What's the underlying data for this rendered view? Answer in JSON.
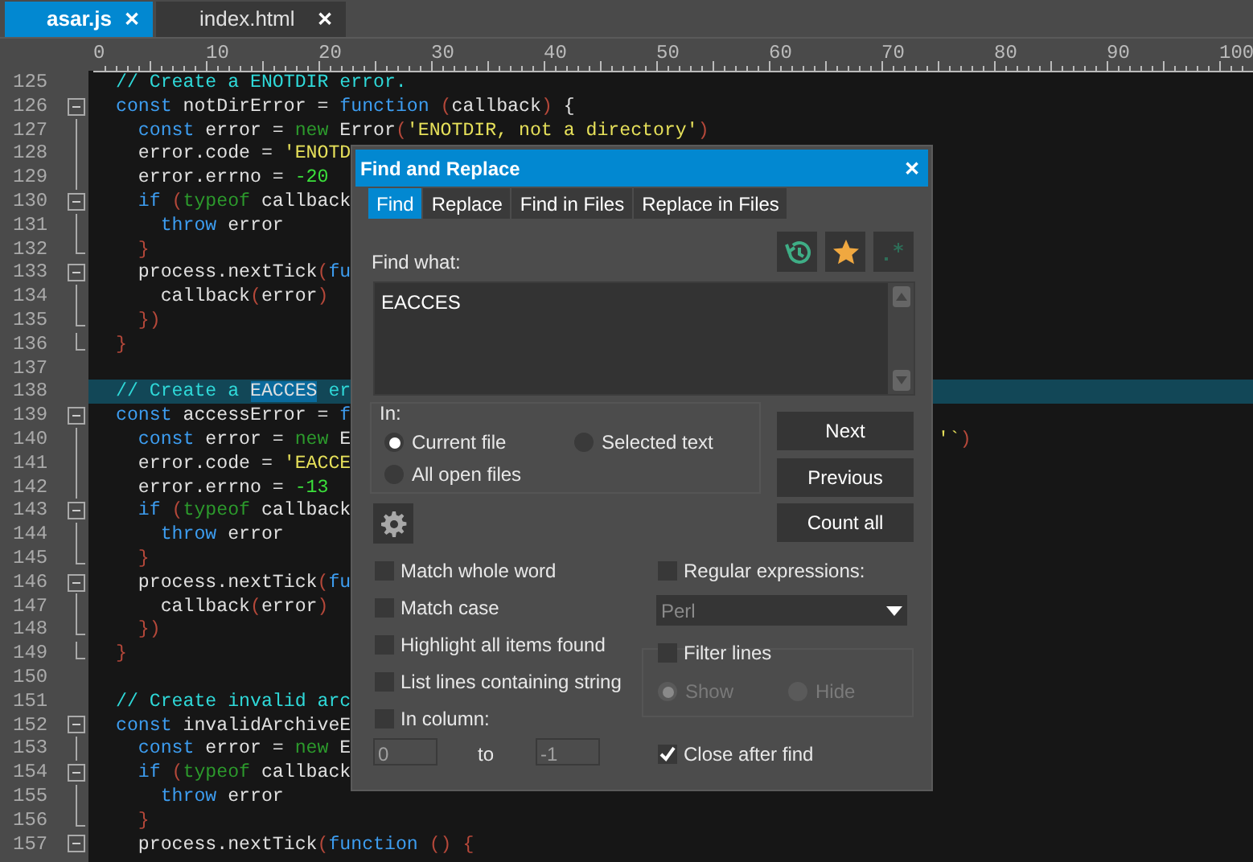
{
  "tabs": [
    {
      "label": "asar.js",
      "selected": true,
      "close": "✕"
    },
    {
      "label": "index.html",
      "selected": false,
      "close": "✕"
    }
  ],
  "ruler": [
    "0",
    "10",
    "20",
    "30",
    "40",
    "50",
    "60",
    "70",
    "80",
    "90",
    "100"
  ],
  "code": [
    {
      "n": "125",
      "kind": "plain",
      "tokens": [
        {
          "kind": "comment",
          "text": "// Create a ENOTDIR error."
        }
      ]
    },
    {
      "n": "126",
      "kind": "fold_start",
      "tokens": [
        {
          "kind": "keyword",
          "text": "const"
        },
        {
          "kind": "plain",
          "text": " notDirError = "
        },
        {
          "kind": "keyword",
          "text": "function"
        },
        {
          "kind": "paren",
          "text": " ("
        },
        {
          "kind": "plain",
          "text": "callback"
        },
        {
          "kind": "paren",
          "text": ")"
        },
        {
          "kind": "plain",
          "text": " {"
        }
      ]
    },
    {
      "n": "127",
      "kind": "fold_body",
      "tokens": [
        {
          "kind": "keyword",
          "text": "  const"
        },
        {
          "kind": "plain",
          "text": " error = "
        },
        {
          "kind": "operator",
          "text": "new"
        },
        {
          "kind": "plain",
          "text": " Error"
        },
        {
          "kind": "paren",
          "text": "("
        },
        {
          "kind": "string",
          "text": "'ENOTDIR, not a directory'"
        },
        {
          "kind": "paren",
          "text": ")"
        }
      ]
    },
    {
      "n": "128",
      "kind": "fold_body",
      "tokens": [
        {
          "kind": "plain",
          "text": "  error.code = "
        },
        {
          "kind": "string",
          "text": "'ENOTD"
        }
      ]
    },
    {
      "n": "129",
      "kind": "fold_body",
      "tokens": [
        {
          "kind": "plain",
          "text": "  error.errno = "
        },
        {
          "kind": "number",
          "text": "-20"
        }
      ]
    },
    {
      "n": "130",
      "kind": "fold_start",
      "tokens": [
        {
          "kind": "keyword",
          "text": "  if"
        },
        {
          "kind": "paren",
          "text": " ("
        },
        {
          "kind": "operator",
          "text": "typeof"
        },
        {
          "kind": "plain",
          "text": " callback"
        }
      ]
    },
    {
      "n": "131",
      "kind": "fold_body",
      "tokens": [
        {
          "kind": "keyword",
          "text": "    throw"
        },
        {
          "kind": "plain",
          "text": " error"
        }
      ]
    },
    {
      "n": "132",
      "kind": "fold_end",
      "tokens": [
        {
          "kind": "paren",
          "text": "  }"
        }
      ]
    },
    {
      "n": "133",
      "kind": "fold_start",
      "tokens": [
        {
          "kind": "plain",
          "text": "  process.nextTick"
        },
        {
          "kind": "paren",
          "text": "("
        },
        {
          "kind": "keyword",
          "text": "fu"
        }
      ]
    },
    {
      "n": "134",
      "kind": "fold_body",
      "tokens": [
        {
          "kind": "plain",
          "text": "    callback"
        },
        {
          "kind": "paren",
          "text": "("
        },
        {
          "kind": "plain",
          "text": "error"
        },
        {
          "kind": "paren",
          "text": ")"
        }
      ]
    },
    {
      "n": "135",
      "kind": "fold_end",
      "tokens": [
        {
          "kind": "paren",
          "text": "  })"
        }
      ]
    },
    {
      "n": "136",
      "kind": "fold_end",
      "tokens": [
        {
          "kind": "paren",
          "text": "}"
        }
      ]
    },
    {
      "n": "137",
      "kind": "plain"
    },
    {
      "n": "138",
      "kind": "plain",
      "current": true,
      "tokens": [
        {
          "kind": "comment",
          "text": "// Create a "
        },
        {
          "kind": "match",
          "text": "EACCES"
        },
        {
          "kind": "comment",
          "text": " er"
        }
      ]
    },
    {
      "n": "139",
      "kind": "fold_start",
      "tokens": [
        {
          "kind": "keyword",
          "text": "const"
        },
        {
          "kind": "plain",
          "text": " accessError = "
        },
        {
          "kind": "keyword",
          "text": "f"
        }
      ]
    },
    {
      "n": "140",
      "kind": "fold_body",
      "tokens": [
        {
          "kind": "keyword",
          "text": "  const"
        },
        {
          "kind": "plain",
          "text": " error = "
        },
        {
          "kind": "operator",
          "text": "new"
        },
        {
          "kind": "plain",
          "text": " E"
        }
      ],
      "tail": [
        {
          "kind": "string",
          "text": "'`"
        },
        {
          "kind": "paren",
          "text": ")"
        }
      ]
    },
    {
      "n": "141",
      "kind": "fold_body",
      "tokens": [
        {
          "kind": "plain",
          "text": "  error.code = "
        },
        {
          "kind": "string",
          "text": "'EACCE"
        }
      ]
    },
    {
      "n": "142",
      "kind": "fold_body",
      "tokens": [
        {
          "kind": "plain",
          "text": "  error.errno = "
        },
        {
          "kind": "number",
          "text": "-13"
        }
      ]
    },
    {
      "n": "143",
      "kind": "fold_start",
      "tokens": [
        {
          "kind": "keyword",
          "text": "  if"
        },
        {
          "kind": "paren",
          "text": " ("
        },
        {
          "kind": "operator",
          "text": "typeof"
        },
        {
          "kind": "plain",
          "text": " callback"
        }
      ]
    },
    {
      "n": "144",
      "kind": "fold_body",
      "tokens": [
        {
          "kind": "keyword",
          "text": "    throw"
        },
        {
          "kind": "plain",
          "text": " error"
        }
      ]
    },
    {
      "n": "145",
      "kind": "fold_end",
      "tokens": [
        {
          "kind": "paren",
          "text": "  }"
        }
      ]
    },
    {
      "n": "146",
      "kind": "fold_start",
      "tokens": [
        {
          "kind": "plain",
          "text": "  process.nextTick"
        },
        {
          "kind": "paren",
          "text": "("
        },
        {
          "kind": "keyword",
          "text": "fu"
        }
      ]
    },
    {
      "n": "147",
      "kind": "fold_body",
      "tokens": [
        {
          "kind": "plain",
          "text": "    callback"
        },
        {
          "kind": "paren",
          "text": "("
        },
        {
          "kind": "plain",
          "text": "error"
        },
        {
          "kind": "paren",
          "text": ")"
        }
      ]
    },
    {
      "n": "148",
      "kind": "fold_end",
      "tokens": [
        {
          "kind": "paren",
          "text": "  })"
        }
      ]
    },
    {
      "n": "149",
      "kind": "fold_end",
      "tokens": [
        {
          "kind": "paren",
          "text": "}"
        }
      ]
    },
    {
      "n": "150",
      "kind": "plain"
    },
    {
      "n": "151",
      "kind": "plain",
      "tokens": [
        {
          "kind": "comment",
          "text": "// Create invalid arc"
        }
      ]
    },
    {
      "n": "152",
      "kind": "fold_start",
      "tokens": [
        {
          "kind": "keyword",
          "text": "const"
        },
        {
          "kind": "plain",
          "text": " invalidArchiveE"
        }
      ]
    },
    {
      "n": "153",
      "kind": "fold_body",
      "tokens": [
        {
          "kind": "keyword",
          "text": "  const"
        },
        {
          "kind": "plain",
          "text": " error = "
        },
        {
          "kind": "operator",
          "text": "new"
        },
        {
          "kind": "plain",
          "text": " E"
        }
      ]
    },
    {
      "n": "154",
      "kind": "fold_start",
      "tokens": [
        {
          "kind": "keyword",
          "text": "  if"
        },
        {
          "kind": "paren",
          "text": " ("
        },
        {
          "kind": "operator",
          "text": "typeof"
        },
        {
          "kind": "plain",
          "text": " callback"
        }
      ]
    },
    {
      "n": "155",
      "kind": "fold_body",
      "tokens": [
        {
          "kind": "keyword",
          "text": "    throw"
        },
        {
          "kind": "plain",
          "text": " error"
        }
      ]
    },
    {
      "n": "156",
      "kind": "fold_end",
      "tokens": [
        {
          "kind": "paren",
          "text": "  }"
        }
      ]
    },
    {
      "n": "157",
      "kind": "fold_start",
      "tokens": [
        {
          "kind": "plain",
          "text": "  process.nextTick"
        },
        {
          "kind": "paren",
          "text": "("
        },
        {
          "kind": "keyword",
          "text": "function"
        },
        {
          "kind": "paren",
          "text": " () {"
        }
      ]
    }
  ],
  "dialog": {
    "title": "Find and Replace",
    "close": "✕",
    "tabs": [
      {
        "label": "Find",
        "selected": true
      },
      {
        "label": "Replace",
        "selected": false
      },
      {
        "label": "Find in Files",
        "selected": false
      },
      {
        "label": "Replace in Files",
        "selected": false
      }
    ],
    "find_label": "Find what:",
    "find_value": "EACCES",
    "in_label": "In:",
    "scope": [
      {
        "label": "Current file",
        "selected": true
      },
      {
        "label": "Selected text",
        "selected": false
      },
      {
        "label": "All open files",
        "selected": false
      }
    ],
    "buttons": [
      "Next",
      "Previous",
      "Count all"
    ],
    "options": [
      {
        "label": "Match whole word",
        "checked": false
      },
      {
        "label": "Match case",
        "checked": false
      },
      {
        "label": "Highlight all items found",
        "checked": false
      },
      {
        "label": "List lines containing string",
        "checked": false
      },
      {
        "label": "In column:",
        "checked": false
      }
    ],
    "column_from": "0",
    "column_to_label": "to",
    "column_to": "-1",
    "regex": {
      "label": "Regular expressions:",
      "checked": false,
      "engine": "Perl"
    },
    "filter": {
      "label": "Filter lines",
      "checked": false,
      "modes": [
        {
          "label": "Show",
          "selected": true
        },
        {
          "label": "Hide",
          "selected": false
        }
      ]
    },
    "close_after": {
      "label": "Close after find",
      "checked": true
    }
  }
}
